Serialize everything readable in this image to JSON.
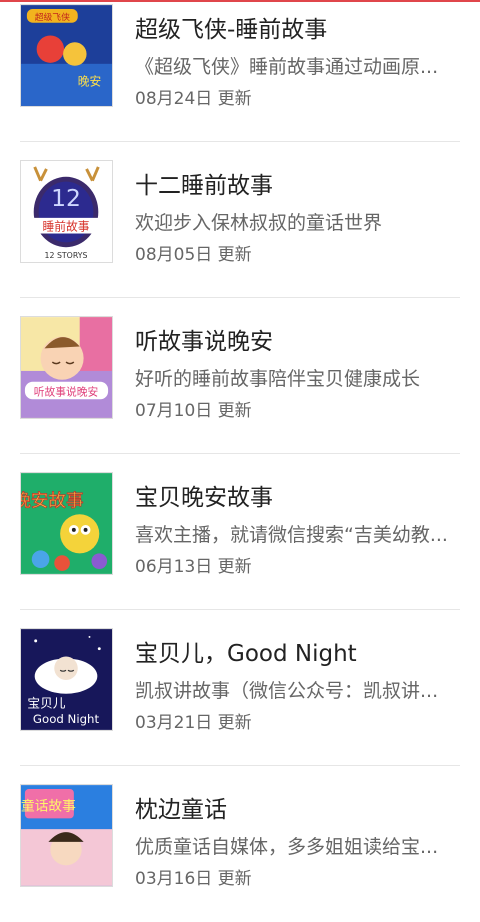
{
  "items": [
    {
      "title": "超级飞侠-睡前故事",
      "desc": "《超级飞侠》睡前故事通过动画原...",
      "date": "08月24日 更新",
      "thumb_text": "超级飞侠"
    },
    {
      "title": "十二睡前故事",
      "desc": "欢迎步入保林叔叔的童话世界",
      "date": "08月05日 更新",
      "thumb_text": "睡前故事",
      "thumb_sub": "12 STORYS"
    },
    {
      "title": "听故事说晚安",
      "desc": "好听的睡前故事陪伴宝贝健康成长",
      "date": "07月10日 更新",
      "thumb_text": "听故事说晚安"
    },
    {
      "title": "宝贝晚安故事",
      "desc": "喜欢主播，就请微信搜索“吉美幼教...",
      "date": "06月13日 更新",
      "thumb_text": "晚安故事"
    },
    {
      "title": "宝贝儿，Good Night",
      "desc": "凯叔讲故事（微信公众号：凯叔讲...",
      "date": "03月21日 更新",
      "thumb_text": "宝贝儿",
      "thumb_sub": "Good Night"
    },
    {
      "title": "枕边童话",
      "desc": "优质童话自媒体，多多姐姐读给宝...",
      "date": "03月16日 更新",
      "thumb_text": "童话故事"
    }
  ]
}
